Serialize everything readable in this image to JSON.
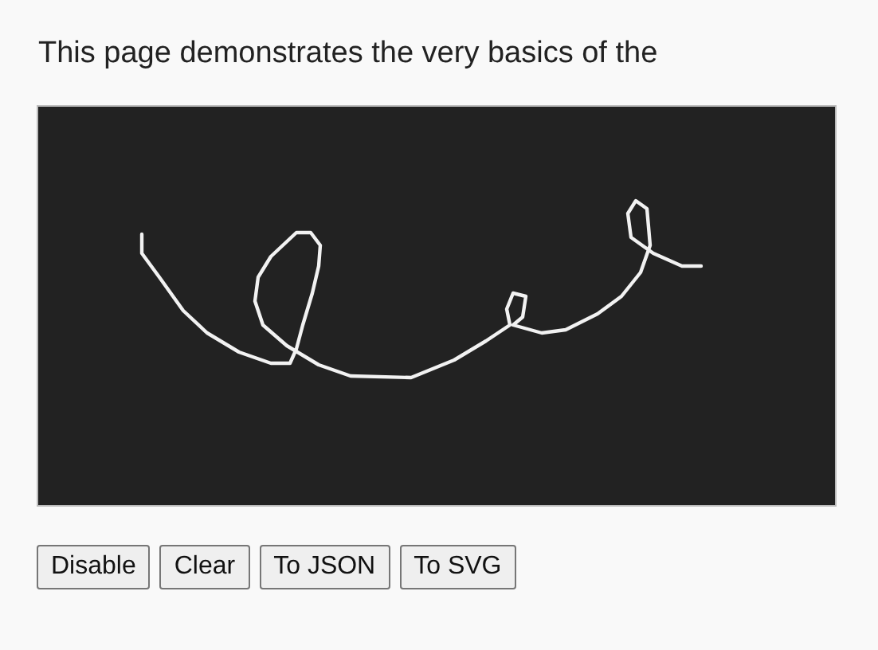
{
  "intro": "This page demonstrates the very basics of the",
  "buttons": [
    "Disable",
    "Clear",
    "To JSON",
    "To SVG"
  ]
}
